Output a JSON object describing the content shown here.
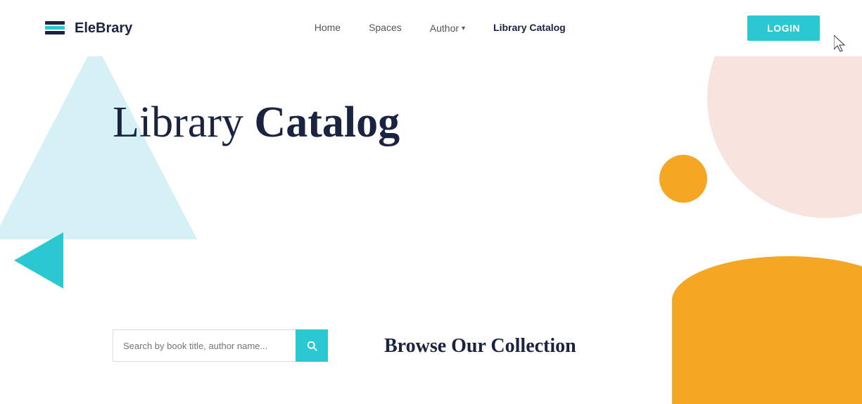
{
  "brand": {
    "logo_text_light": "Ele",
    "logo_text_bold": "Brary"
  },
  "navbar": {
    "links": [
      {
        "id": "home",
        "label": "Home",
        "active": false
      },
      {
        "id": "spaces",
        "label": "Spaces",
        "active": false
      },
      {
        "id": "author",
        "label": "Author",
        "has_dropdown": true,
        "active": false
      },
      {
        "id": "library-catalog",
        "label": "Library Catalog",
        "active": true
      }
    ],
    "login_label": "LOGIN"
  },
  "hero": {
    "title_light": "Library ",
    "title_bold": "Catalog"
  },
  "search": {
    "placeholder": "Search by book title, author name..."
  },
  "browse": {
    "title": "Browse Our Collection"
  },
  "colors": {
    "teal": "#2ac8d0",
    "navy": "#1a2340",
    "pink": "#f8e4df",
    "yellow": "#f5a623",
    "triangle_blue": "rgba(164,223,234,0.45)"
  }
}
